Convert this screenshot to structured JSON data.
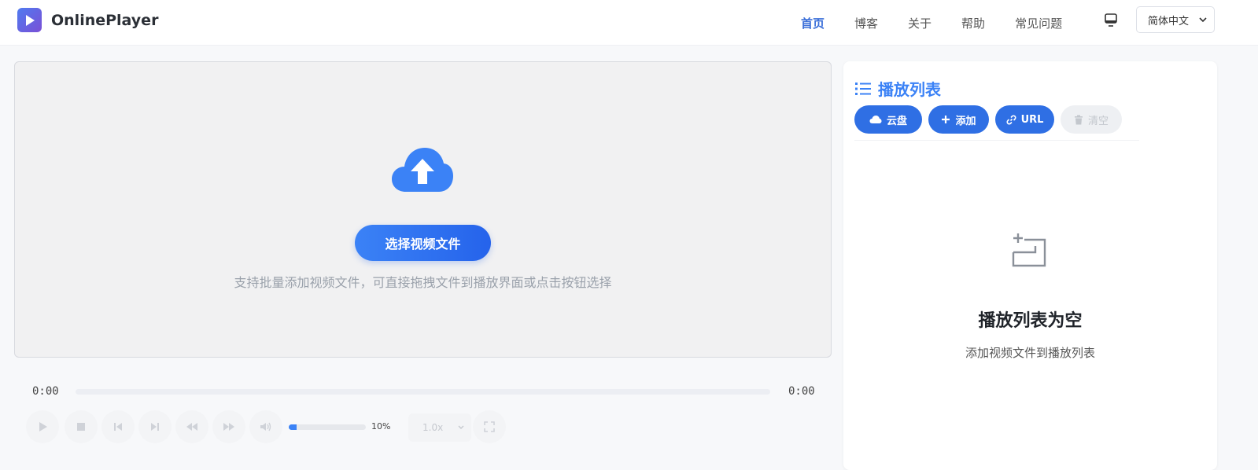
{
  "app": {
    "name": "OnlinePlayer",
    "logo_icon": "play-icon"
  },
  "nav": {
    "items": [
      {
        "label": "首页",
        "active": true
      },
      {
        "label": "博客",
        "active": false
      },
      {
        "label": "关于",
        "active": false
      },
      {
        "label": "帮助",
        "active": false
      },
      {
        "label": "常见问题",
        "active": false
      }
    ],
    "display_icon": "monitor-icon",
    "language": {
      "selected": "简体中文"
    }
  },
  "player": {
    "upload_icon": "cloud-upload-icon",
    "choose_button": "选择视频文件",
    "hint": "支持批量添加视频文件，可直接拖拽文件到播放界面或点击按钮选择",
    "current_time": "0:00",
    "duration": "0:00",
    "progress": 0,
    "controls": [
      "play-icon",
      "stop-icon",
      "previous-icon",
      "next-icon",
      "rewind-icon",
      "fast-forward-icon",
      "volume-icon",
      "fullscreen-icon"
    ],
    "volume": {
      "value": 0.1,
      "label": "10%"
    },
    "speed": {
      "selected": "1.0x"
    }
  },
  "playlist": {
    "title": "播放列表",
    "title_icon": "list-icon",
    "buttons": [
      {
        "label": "云盘",
        "icon": "cloud-icon",
        "enabled": true
      },
      {
        "label": "添加",
        "icon": "plus-icon",
        "enabled": true
      },
      {
        "label": "URL",
        "icon": "link-icon",
        "enabled": true
      },
      {
        "label": "清空",
        "icon": "trash-icon",
        "enabled": false
      }
    ],
    "empty": {
      "icon": "empty-playlist-icon",
      "title": "播放列表为空",
      "subtitle": "添加视频文件到播放列表"
    }
  },
  "colors": {
    "accent": "#3b82f6",
    "accent_dark": "#2563eb",
    "nav_active": "#3b6fd9"
  }
}
